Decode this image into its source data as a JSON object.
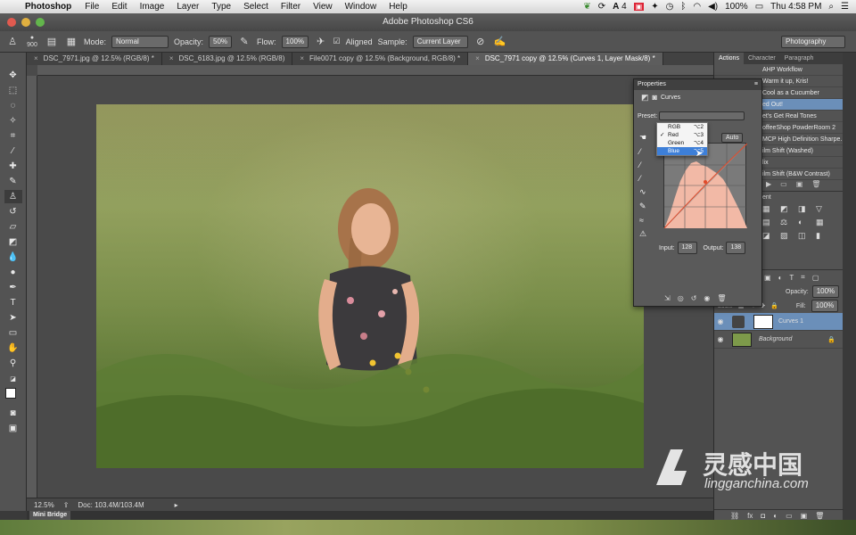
{
  "menubar": {
    "app": "Photoshop",
    "items": [
      "File",
      "Edit",
      "Image",
      "Layer",
      "Type",
      "Select",
      "Filter",
      "View",
      "Window",
      "Help"
    ],
    "battery": "100%",
    "clock": "Thu 4:58 PM",
    "badge": "4"
  },
  "window": {
    "title": "Adobe Photoshop CS6"
  },
  "options": {
    "brush_size": "900",
    "mode_label": "Mode:",
    "mode_value": "Normal",
    "opacity_label": "Opacity:",
    "opacity_value": "50%",
    "flow_label": "Flow:",
    "flow_value": "100%",
    "aligned_label": "Aligned",
    "sample_label": "Sample:",
    "sample_value": "Current Layer",
    "workspace": "Photography"
  },
  "tabs": [
    {
      "label": "DSC_7971.jpg @ 12.5% (RGB/8) *"
    },
    {
      "label": "DSC_6183.jpg @ 12.5% (RGB/8)"
    },
    {
      "label": "File0071 copy @ 12.5% (Background, RGB/8) *"
    },
    {
      "label": "DSC_7971 copy @ 12.5% (Curves 1, Layer Mask/8) *"
    }
  ],
  "status": {
    "zoom": "12.5%",
    "doc": "Doc: 103.4M/103.4M"
  },
  "bridge": {
    "label": "Mini Bridge"
  },
  "dock": {
    "tabs": [
      "Actions",
      "Character",
      "Paragraph"
    ],
    "actions": [
      {
        "label": "AHP Workflow",
        "selected": false
      },
      {
        "label": "Warm it up, Kris!",
        "selected": false
      },
      {
        "label": "Cool as a Cucumber",
        "selected": false
      },
      {
        "label": "ed Out!",
        "selected": true
      },
      {
        "label": "et's Get Real Tones",
        "selected": false
      },
      {
        "label": "offeeShop PowderRoom 2",
        "selected": false
      },
      {
        "label": "MCP High Definition Sharpe...",
        "selected": false
      },
      {
        "label": "ilm Shift (Washed)",
        "selected": false
      },
      {
        "label": "lix",
        "selected": false
      },
      {
        "label": "ilm Shift (B&W Contrast)",
        "selected": false
      }
    ],
    "adjust_label": "ent",
    "opacity_label": "Opacity:",
    "opacity_value": "100%",
    "lock_label": "Lock:",
    "fill_label": "Fill:",
    "fill_value": "100%",
    "layers": [
      {
        "name": "Curves 1",
        "selected": true
      },
      {
        "name": "Background",
        "selected": false
      }
    ]
  },
  "properties": {
    "header": "Properties",
    "title": "Curves",
    "preset_label": "Preset:",
    "auto_label": "Auto",
    "input_label": "Input:",
    "input_value": "128",
    "output_label": "Output:",
    "output_value": "138",
    "channels": [
      {
        "label": "RGB",
        "key": "⌥2",
        "checked": false
      },
      {
        "label": "Red",
        "key": "⌥3",
        "checked": true
      },
      {
        "label": "Green",
        "key": "⌥4",
        "checked": false
      },
      {
        "label": "Blue",
        "key": "⌥5",
        "checked": false
      }
    ]
  },
  "watermark": {
    "brand": "灵感中国",
    "site": "lingganchina.com"
  }
}
